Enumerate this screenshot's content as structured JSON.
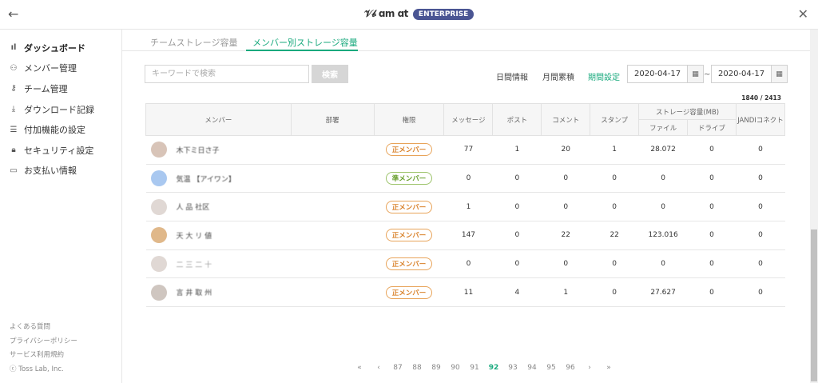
{
  "topbar": {
    "brand": "𝒱𝒷 ɑm ɑt",
    "badge": "ENTERPRISE"
  },
  "sidebar": {
    "items": [
      {
        "label": "ダッシュボード",
        "icon": "bar-chart-icon"
      },
      {
        "label": "メンバー管理",
        "icon": "users-icon"
      },
      {
        "label": "チーム管理",
        "icon": "key-icon"
      },
      {
        "label": "ダウンロード記録",
        "icon": "download-icon"
      },
      {
        "label": "付加機能の設定",
        "icon": "sliders-icon"
      },
      {
        "label": "セキュリティ設定",
        "icon": "lock-icon"
      },
      {
        "label": "お支払い情報",
        "icon": "card-icon"
      }
    ],
    "footer": [
      "よくある質問",
      "プライバシーポリシー",
      "サービス利用規約",
      "ⓒ Toss Lab, Inc."
    ]
  },
  "tabs": [
    "チームストレージ容量",
    "メンバー別ストレージ容量"
  ],
  "search": {
    "placeholder": "キーワードで検索",
    "button": "検索"
  },
  "filters": [
    "日間情報",
    "月間累積",
    "期間設定"
  ],
  "date_from": "2020-04-17",
  "date_to": "2020-04-17",
  "tilde": "~",
  "count": "1840 / 2413",
  "table": {
    "headers": {
      "member": "メンバー",
      "dept": "部署",
      "role": "権限",
      "message": "メッセージ",
      "post": "ポスト",
      "comment": "コメント",
      "stamp": "スタンプ",
      "storage": "ストレージ容量(MB)",
      "file": "ファイル",
      "drive": "ドライブ",
      "jandi": "JANDIコネクト"
    },
    "rows": [
      {
        "name": "木下ミ日さ子",
        "role": "正メンバー",
        "msg": "77",
        "post": "1",
        "comment": "20",
        "stamp": "1",
        "file": "28.072",
        "drive": "0",
        "jandi": "0"
      },
      {
        "name": "気温 【アイワン】",
        "role": "準メンバー",
        "msg": "0",
        "post": "0",
        "comment": "0",
        "stamp": "0",
        "file": "0",
        "drive": "0",
        "jandi": "0"
      },
      {
        "name": "人 品 社区",
        "role": "正メンバー",
        "msg": "1",
        "post": "0",
        "comment": "0",
        "stamp": "0",
        "file": "0",
        "drive": "0",
        "jandi": "0"
      },
      {
        "name": "天 大 リ 値",
        "role": "正メンバー",
        "msg": "147",
        "post": "0",
        "comment": "22",
        "stamp": "22",
        "file": "123.016",
        "drive": "0",
        "jandi": "0"
      },
      {
        "name": "二 三 二 十",
        "role": "正メンバー",
        "msg": "0",
        "post": "0",
        "comment": "0",
        "stamp": "0",
        "file": "0",
        "drive": "0",
        "jandi": "0"
      },
      {
        "name": "言 井 取 州",
        "role": "正メンバー",
        "msg": "11",
        "post": "4",
        "comment": "1",
        "stamp": "0",
        "file": "27.627",
        "drive": "0",
        "jandi": "0"
      }
    ]
  },
  "pager": {
    "first": "«",
    "prev": "‹",
    "pages": [
      "87",
      "88",
      "89",
      "90",
      "91",
      "92",
      "93",
      "94",
      "95",
      "96"
    ],
    "current": "92",
    "next": "›",
    "last": "»"
  }
}
